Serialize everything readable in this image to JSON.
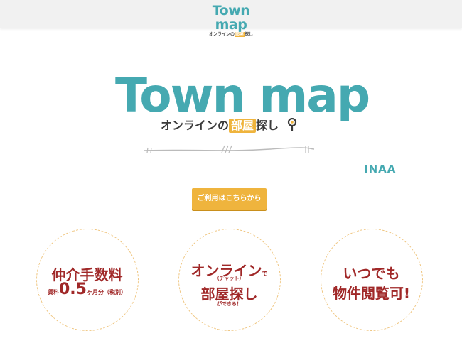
{
  "header": {
    "logo_word": "Town map",
    "logo_tag_pre": "オンラインの",
    "logo_tag_box": "部屋",
    "logo_tag_post": "探し"
  },
  "hero": {
    "logo_word": "Town map",
    "tag_pre": "オンラインの",
    "tag_box": "部屋",
    "tag_post": "探し"
  },
  "brand": "INAA",
  "cta_label": "ご利用はこちらから",
  "features": {
    "f1": {
      "title": "仲介手数料",
      "prefix": "賃料",
      "value": "0.5",
      "suffix": "ヶ月分（税別）"
    },
    "f2": {
      "line1": "オンライン",
      "line1_suffix": "で",
      "sub": "（チャット）",
      "line2": "部屋探し",
      "line3": "ができる！"
    },
    "f3": {
      "line1": "いつでも",
      "line2": "物件閲覧可!"
    }
  },
  "colors": {
    "teal": "#45a9b1",
    "yellow": "#efb43d",
    "red": "#a02828"
  }
}
